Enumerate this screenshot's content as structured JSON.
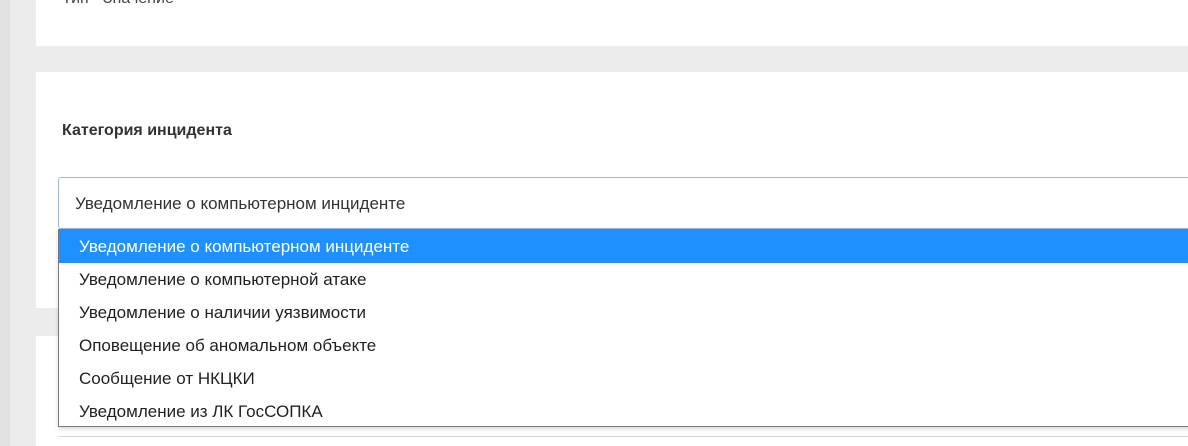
{
  "top_section": {
    "cut_text": "Тип - Значение"
  },
  "field": {
    "label": "Категория инцидента",
    "selected_value": "Уведомление о компьютерном инциденте"
  },
  "dropdown": {
    "options": [
      "Уведомление о компьютерном инциденте",
      "Уведомление о компьютерной атаке",
      "Уведомление о наличии уязвимости",
      "Оповещение об аномальном объекте",
      "Сообщение от НКЦКИ",
      "Уведомление из ЛК ГосСОПКА"
    ],
    "highlighted_index": 0
  },
  "colors": {
    "highlight": "#1e90ff",
    "select_border": "#9fb6d9",
    "page_background": "#ececec"
  }
}
